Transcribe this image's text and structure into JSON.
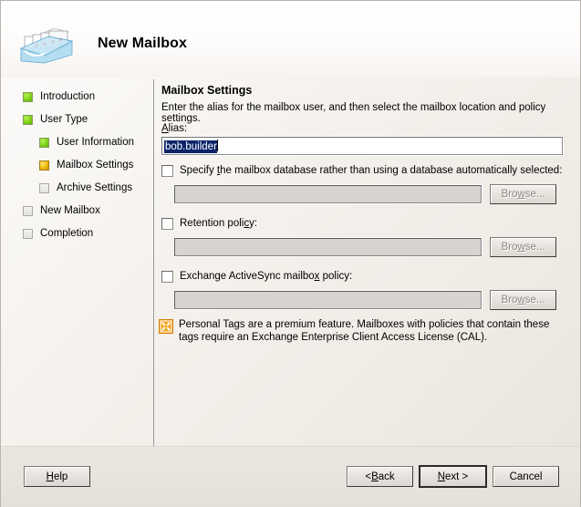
{
  "window": {
    "title": "New Mailbox",
    "icon": "mailbox-tray-icon"
  },
  "sidebar": {
    "items": [
      {
        "label": "Introduction",
        "state": "done",
        "level": 0,
        "icon": "step-status-icon"
      },
      {
        "label": "User Type",
        "state": "done",
        "level": 0,
        "icon": "step-status-icon"
      },
      {
        "label": "User Information",
        "state": "done",
        "level": 1,
        "icon": "step-status-icon"
      },
      {
        "label": "Mailbox Settings",
        "state": "current",
        "level": 1,
        "icon": "step-status-icon"
      },
      {
        "label": "Archive Settings",
        "state": "pending",
        "level": 1,
        "icon": "step-status-icon"
      },
      {
        "label": "New Mailbox",
        "state": "pending",
        "level": 0,
        "icon": "step-status-icon"
      },
      {
        "label": "Completion",
        "state": "pending",
        "level": 0,
        "icon": "step-status-icon"
      }
    ]
  },
  "main": {
    "title": "Mailbox Settings",
    "description": "Enter the alias for the mailbox user, and then select the mailbox location and policy settings.",
    "alias": {
      "label_pre": "",
      "label_mnemonic": "A",
      "label_post": "lias:",
      "value": "bob.builder",
      "selected": true
    },
    "options": [
      {
        "id": "mailbox-database",
        "checked": false,
        "label_pre": "Specify ",
        "label_mnemonic": "t",
        "label_post": "he mailbox database rather than using a database automatically selected:",
        "input_value": "",
        "input_enabled": false,
        "browse_label_pre": "Bro",
        "browse_mnemonic": "w",
        "browse_label_post": "se...",
        "browse_enabled": false
      },
      {
        "id": "retention-policy",
        "checked": false,
        "label_pre": "Retention poli",
        "label_mnemonic": "c",
        "label_post": "y:",
        "input_value": "",
        "input_enabled": false,
        "browse_label_pre": "Bro",
        "browse_mnemonic": "w",
        "browse_label_post": "se...",
        "browse_enabled": false
      },
      {
        "id": "activesync-policy",
        "checked": false,
        "label_pre": "Exchange ActiveSync mailbo",
        "label_mnemonic": "x",
        "label_post": " policy:",
        "input_value": "",
        "input_enabled": false,
        "browse_label_pre": "Bro",
        "browse_mnemonic": "w",
        "browse_label_post": "se...",
        "browse_enabled": false
      }
    ],
    "notice": {
      "icon": "premium-tag-icon",
      "text": "Personal Tags are a premium feature. Mailboxes with policies that contain these tags require an Exchange Enterprise Client Access License (CAL)."
    }
  },
  "footer": {
    "help": {
      "pre": "",
      "mnemonic": "H",
      "post": "elp"
    },
    "back": {
      "pre": "< ",
      "mnemonic": "B",
      "post": "ack"
    },
    "next": {
      "pre": "",
      "mnemonic": "N",
      "post": "ext >",
      "default": true
    },
    "cancel": {
      "pre": "Cancel",
      "mnemonic": "",
      "post": ""
    }
  },
  "colors": {
    "step_done": "#86d71c",
    "step_current": "#f4bf13",
    "step_pending": "#e4e2de",
    "selection": "#0a246a",
    "notice_icon": "#f09a18",
    "window_bg": "#ede9e3"
  }
}
